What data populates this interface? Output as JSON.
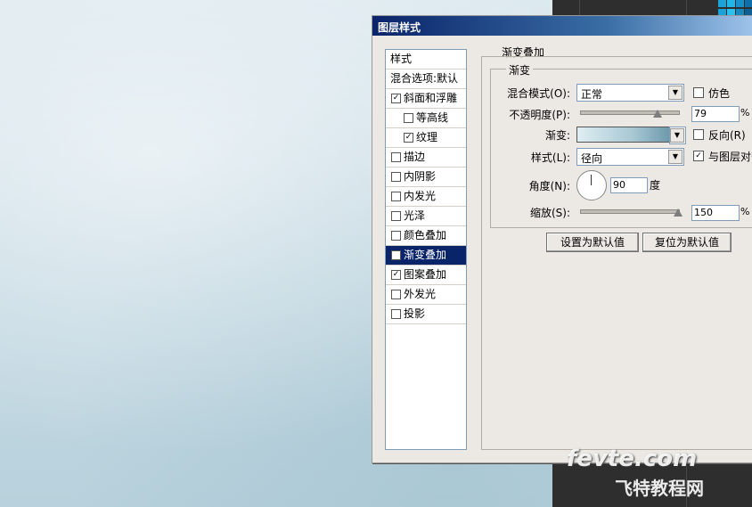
{
  "dialog": {
    "title": "图层样式",
    "left_panel": {
      "header": "样式",
      "blend_options": "混合选项:默认",
      "items": [
        {
          "label": "斜面和浮雕",
          "checked": true,
          "sub": false
        },
        {
          "label": "等高线",
          "checked": false,
          "sub": true
        },
        {
          "label": "纹理",
          "checked": true,
          "sub": true
        },
        {
          "label": "描边",
          "checked": false,
          "sub": false
        },
        {
          "label": "内阴影",
          "checked": false,
          "sub": false
        },
        {
          "label": "内发光",
          "checked": false,
          "sub": false
        },
        {
          "label": "光泽",
          "checked": false,
          "sub": false
        },
        {
          "label": "颜色叠加",
          "checked": false,
          "sub": false
        },
        {
          "label": "渐变叠加",
          "checked": true,
          "sub": false,
          "selected": true
        },
        {
          "label": "图案叠加",
          "checked": true,
          "sub": false
        },
        {
          "label": "外发光",
          "checked": false,
          "sub": false
        },
        {
          "label": "投影",
          "checked": false,
          "sub": false
        }
      ]
    },
    "gradient_overlay": {
      "section_title": "渐变叠加",
      "group_title": "渐变",
      "blend_mode_label": "混合模式(O):",
      "blend_mode_value": "正常",
      "dither_label": "仿色",
      "dither_checked": false,
      "opacity_label": "不透明度(P):",
      "opacity_value": "79",
      "opacity_unit": "%",
      "opacity_fraction": 0.79,
      "gradient_label": "渐变:",
      "reverse_label": "反向(R)",
      "reverse_checked": false,
      "style_label": "样式(L):",
      "style_value": "径向",
      "align_label": "与图层对齐",
      "align_checked": true,
      "angle_label": "角度(N):",
      "angle_value": "90",
      "angle_unit": "度",
      "scale_label": "缩放(S):",
      "scale_value": "150",
      "scale_unit": "%",
      "scale_fraction": 1.0,
      "make_default_button": "设置为默认值",
      "reset_default_button": "复位为默认值"
    }
  },
  "watermark": {
    "site": "fevte.com",
    "cn": "飞特教程网"
  },
  "colors": {
    "title_start": "#0a246a",
    "title_end": "#a6caf0",
    "selected_row": "#0a246a",
    "dialog_bg": "#ece9e5"
  }
}
